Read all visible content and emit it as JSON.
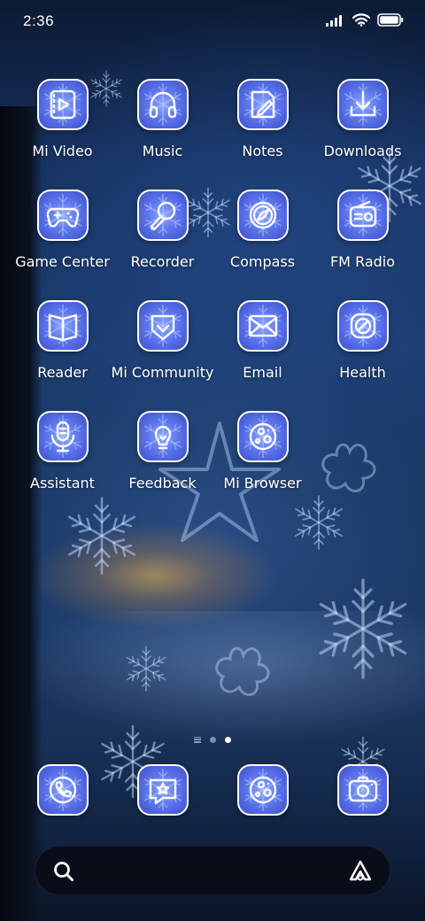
{
  "status_bar": {
    "time": "2:36",
    "icons": [
      "signal-icon",
      "wifi-icon",
      "battery-icon"
    ]
  },
  "apps": [
    {
      "label": "Mi Video",
      "icon": "video-icon"
    },
    {
      "label": "Music",
      "icon": "headphones-icon"
    },
    {
      "label": "Notes",
      "icon": "pencil-icon"
    },
    {
      "label": "Downloads",
      "icon": "download-icon"
    },
    {
      "label": "Game Center",
      "icon": "gamepad-icon"
    },
    {
      "label": "Recorder",
      "icon": "microphone-icon"
    },
    {
      "label": "Compass",
      "icon": "compass-icon"
    },
    {
      "label": "FM Radio",
      "icon": "radio-icon"
    },
    {
      "label": "Reader",
      "icon": "book-icon"
    },
    {
      "label": "Mi Community",
      "icon": "community-icon"
    },
    {
      "label": "Email",
      "icon": "envelope-icon"
    },
    {
      "label": "Health",
      "icon": "health-icon"
    },
    {
      "label": "Assistant",
      "icon": "assistant-mic-icon"
    },
    {
      "label": "Feedback",
      "icon": "lightbulb-icon"
    },
    {
      "label": "Mi Browser",
      "icon": "browser-icon"
    }
  ],
  "dock": [
    {
      "icon": "phone-icon"
    },
    {
      "icon": "messages-icon"
    },
    {
      "icon": "browser-icon"
    },
    {
      "icon": "camera-icon"
    }
  ],
  "page_indicator": {
    "pages": 2,
    "active": 2
  },
  "search_bar": {
    "left_icon": "search-icon",
    "right_icon": "assistant-icon"
  },
  "colors": {
    "icon_gradient_center": "#8fa9ff",
    "icon_gradient_edge": "#3e4fc8",
    "icon_border": "#ffffff",
    "search_bar": "#080c16"
  }
}
